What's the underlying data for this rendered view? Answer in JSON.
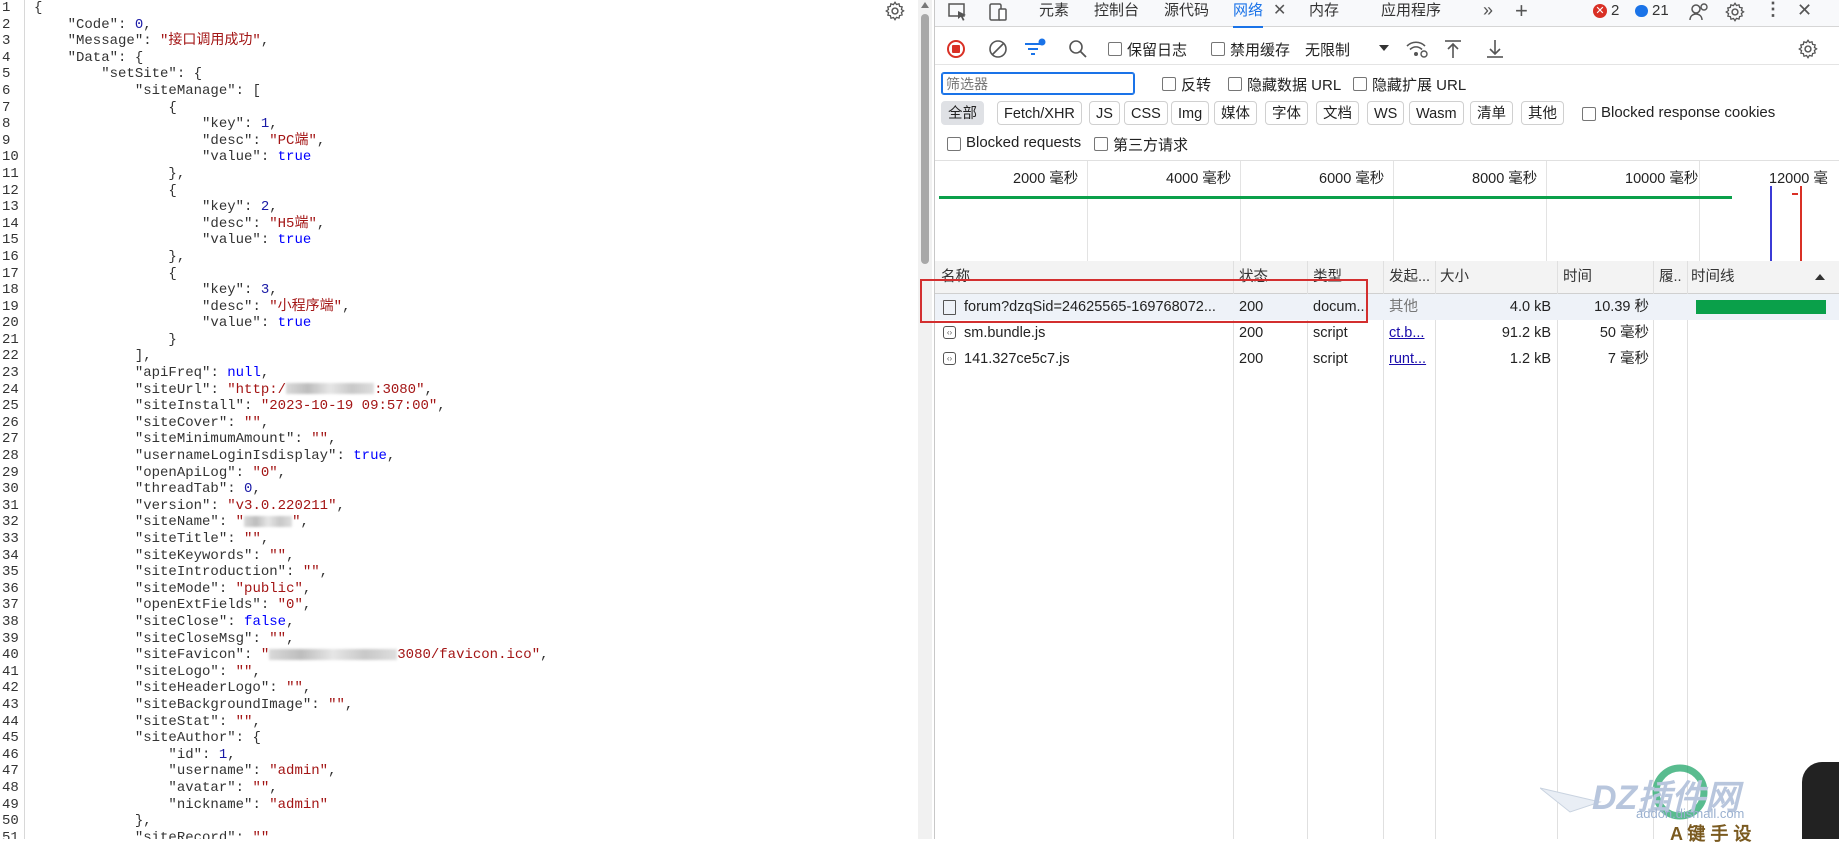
{
  "json_viewer": {
    "line_numbers": [
      "1",
      "2",
      "3",
      "4",
      "5",
      "6",
      "7",
      "8",
      "9",
      "10",
      "11",
      "12",
      "13",
      "14",
      "15",
      "16",
      "17",
      "18",
      "19",
      "20",
      "21",
      "22",
      "23",
      "24",
      "25",
      "26",
      "27",
      "28",
      "29",
      "30",
      "31",
      "32",
      "33",
      "34",
      "35",
      "36",
      "37",
      "38",
      "39",
      "40",
      "41",
      "42",
      "43",
      "44",
      "45",
      "46",
      "47",
      "48",
      "49",
      "50",
      "51"
    ],
    "lines": [
      [
        {
          "t": "{",
          "c": "p"
        }
      ],
      [
        {
          "t": "    \"Code\"",
          "c": "k"
        },
        {
          "t": ": ",
          "c": "p"
        },
        {
          "t": "0",
          "c": "n"
        },
        {
          "t": ",",
          "c": "p"
        }
      ],
      [
        {
          "t": "    \"Message\"",
          "c": "k"
        },
        {
          "t": ": ",
          "c": "p"
        },
        {
          "t": "\"接口调用成功\"",
          "c": "s"
        },
        {
          "t": ",",
          "c": "p"
        }
      ],
      [
        {
          "t": "    \"Data\"",
          "c": "k"
        },
        {
          "t": ": {",
          "c": "p"
        }
      ],
      [
        {
          "t": "        \"setSite\"",
          "c": "k"
        },
        {
          "t": ": {",
          "c": "p"
        }
      ],
      [
        {
          "t": "            \"siteManage\"",
          "c": "k"
        },
        {
          "t": ": [",
          "c": "p"
        }
      ],
      [
        {
          "t": "                {",
          "c": "p"
        }
      ],
      [
        {
          "t": "                    \"key\"",
          "c": "k"
        },
        {
          "t": ": ",
          "c": "p"
        },
        {
          "t": "1",
          "c": "n"
        },
        {
          "t": ",",
          "c": "p"
        }
      ],
      [
        {
          "t": "                    \"desc\"",
          "c": "k"
        },
        {
          "t": ": ",
          "c": "p"
        },
        {
          "t": "\"PC端\"",
          "c": "s"
        },
        {
          "t": ",",
          "c": "p"
        }
      ],
      [
        {
          "t": "                    \"value\"",
          "c": "k"
        },
        {
          "t": ": ",
          "c": "p"
        },
        {
          "t": "true",
          "c": "b"
        }
      ],
      [
        {
          "t": "                },",
          "c": "p"
        }
      ],
      [
        {
          "t": "                {",
          "c": "p"
        }
      ],
      [
        {
          "t": "                    \"key\"",
          "c": "k"
        },
        {
          "t": ": ",
          "c": "p"
        },
        {
          "t": "2",
          "c": "n"
        },
        {
          "t": ",",
          "c": "p"
        }
      ],
      [
        {
          "t": "                    \"desc\"",
          "c": "k"
        },
        {
          "t": ": ",
          "c": "p"
        },
        {
          "t": "\"H5端\"",
          "c": "s"
        },
        {
          "t": ",",
          "c": "p"
        }
      ],
      [
        {
          "t": "                    \"value\"",
          "c": "k"
        },
        {
          "t": ": ",
          "c": "p"
        },
        {
          "t": "true",
          "c": "b"
        }
      ],
      [
        {
          "t": "                },",
          "c": "p"
        }
      ],
      [
        {
          "t": "                {",
          "c": "p"
        }
      ],
      [
        {
          "t": "                    \"key\"",
          "c": "k"
        },
        {
          "t": ": ",
          "c": "p"
        },
        {
          "t": "3",
          "c": "n"
        },
        {
          "t": ",",
          "c": "p"
        }
      ],
      [
        {
          "t": "                    \"desc\"",
          "c": "k"
        },
        {
          "t": ": ",
          "c": "p"
        },
        {
          "t": "\"小程序端\"",
          "c": "s"
        },
        {
          "t": ",",
          "c": "p"
        }
      ],
      [
        {
          "t": "                    \"value\"",
          "c": "k"
        },
        {
          "t": ": ",
          "c": "p"
        },
        {
          "t": "true",
          "c": "b"
        }
      ],
      [
        {
          "t": "                }",
          "c": "p"
        }
      ],
      [
        {
          "t": "            ],",
          "c": "p"
        }
      ],
      [
        {
          "t": "            \"apiFreq\"",
          "c": "k"
        },
        {
          "t": ": ",
          "c": "p"
        },
        {
          "t": "null",
          "c": "b"
        },
        {
          "t": ",",
          "c": "p"
        }
      ],
      [
        {
          "t": "            \"siteUrl\"",
          "c": "k"
        },
        {
          "t": ": ",
          "c": "p"
        },
        {
          "t": "\"http:/",
          "c": "s"
        },
        {
          "blur": 11
        },
        {
          "t": ":3080\"",
          "c": "s"
        },
        {
          "t": ",",
          "c": "p"
        }
      ],
      [
        {
          "t": "            \"siteInstall\"",
          "c": "k"
        },
        {
          "t": ": ",
          "c": "p"
        },
        {
          "t": "\"2023-10-19 09:57:00\"",
          "c": "s"
        },
        {
          "t": ",",
          "c": "p"
        }
      ],
      [
        {
          "t": "            \"siteCover\"",
          "c": "k"
        },
        {
          "t": ": ",
          "c": "p"
        },
        {
          "t": "\"\"",
          "c": "s"
        },
        {
          "t": ",",
          "c": "p"
        }
      ],
      [
        {
          "t": "            \"siteMinimumAmount\"",
          "c": "k"
        },
        {
          "t": ": ",
          "c": "p"
        },
        {
          "t": "\"\"",
          "c": "s"
        },
        {
          "t": ",",
          "c": "p"
        }
      ],
      [
        {
          "t": "            \"usernameLoginIsdisplay\"",
          "c": "k"
        },
        {
          "t": ": ",
          "c": "p"
        },
        {
          "t": "true",
          "c": "b"
        },
        {
          "t": ",",
          "c": "p"
        }
      ],
      [
        {
          "t": "            \"openApiLog\"",
          "c": "k"
        },
        {
          "t": ": ",
          "c": "p"
        },
        {
          "t": "\"0\"",
          "c": "s"
        },
        {
          "t": ",",
          "c": "p"
        }
      ],
      [
        {
          "t": "            \"threadTab\"",
          "c": "k"
        },
        {
          "t": ": ",
          "c": "p"
        },
        {
          "t": "0",
          "c": "n"
        },
        {
          "t": ",",
          "c": "p"
        }
      ],
      [
        {
          "t": "            \"version\"",
          "c": "k"
        },
        {
          "t": ": ",
          "c": "p"
        },
        {
          "t": "\"v3.0.220211\"",
          "c": "s"
        },
        {
          "t": ",",
          "c": "p"
        }
      ],
      [
        {
          "t": "            \"siteName\"",
          "c": "k"
        },
        {
          "t": ": ",
          "c": "p"
        },
        {
          "t": "\"",
          "c": "s"
        },
        {
          "blur": 6
        },
        {
          "t": "\"",
          "c": "s"
        },
        {
          "t": ",",
          "c": "p"
        }
      ],
      [
        {
          "t": "            \"siteTitle\"",
          "c": "k"
        },
        {
          "t": ": ",
          "c": "p"
        },
        {
          "t": "\"\"",
          "c": "s"
        },
        {
          "t": ",",
          "c": "p"
        }
      ],
      [
        {
          "t": "            \"siteKeywords\"",
          "c": "k"
        },
        {
          "t": ": ",
          "c": "p"
        },
        {
          "t": "\"\"",
          "c": "s"
        },
        {
          "t": ",",
          "c": "p"
        }
      ],
      [
        {
          "t": "            \"siteIntroduction\"",
          "c": "k"
        },
        {
          "t": ": ",
          "c": "p"
        },
        {
          "t": "\"\"",
          "c": "s"
        },
        {
          "t": ",",
          "c": "p"
        }
      ],
      [
        {
          "t": "            \"siteMode\"",
          "c": "k"
        },
        {
          "t": ": ",
          "c": "p"
        },
        {
          "t": "\"public\"",
          "c": "s"
        },
        {
          "t": ",",
          "c": "p"
        }
      ],
      [
        {
          "t": "            \"openExtFields\"",
          "c": "k"
        },
        {
          "t": ": ",
          "c": "p"
        },
        {
          "t": "\"0\"",
          "c": "s"
        },
        {
          "t": ",",
          "c": "p"
        }
      ],
      [
        {
          "t": "            \"siteClose\"",
          "c": "k"
        },
        {
          "t": ": ",
          "c": "p"
        },
        {
          "t": "false",
          "c": "b"
        },
        {
          "t": ",",
          "c": "p"
        }
      ],
      [
        {
          "t": "            \"siteCloseMsg\"",
          "c": "k"
        },
        {
          "t": ": ",
          "c": "p"
        },
        {
          "t": "\"\"",
          "c": "s"
        },
        {
          "t": ",",
          "c": "p"
        }
      ],
      [
        {
          "t": "            \"siteFavicon\"",
          "c": "k"
        },
        {
          "t": ": ",
          "c": "p"
        },
        {
          "t": "\"",
          "c": "s"
        },
        {
          "blur": 16
        },
        {
          "t": "3080/favicon.ico\"",
          "c": "s"
        },
        {
          "t": ",",
          "c": "p"
        }
      ],
      [
        {
          "t": "            \"siteLogo\"",
          "c": "k"
        },
        {
          "t": ": ",
          "c": "p"
        },
        {
          "t": "\"\"",
          "c": "s"
        },
        {
          "t": ",",
          "c": "p"
        }
      ],
      [
        {
          "t": "            \"siteHeaderLogo\"",
          "c": "k"
        },
        {
          "t": ": ",
          "c": "p"
        },
        {
          "t": "\"\"",
          "c": "s"
        },
        {
          "t": ",",
          "c": "p"
        }
      ],
      [
        {
          "t": "            \"siteBackgroundImage\"",
          "c": "k"
        },
        {
          "t": ": ",
          "c": "p"
        },
        {
          "t": "\"\"",
          "c": "s"
        },
        {
          "t": ",",
          "c": "p"
        }
      ],
      [
        {
          "t": "            \"siteStat\"",
          "c": "k"
        },
        {
          "t": ": ",
          "c": "p"
        },
        {
          "t": "\"\"",
          "c": "s"
        },
        {
          "t": ",",
          "c": "p"
        }
      ],
      [
        {
          "t": "            \"siteAuthor\"",
          "c": "k"
        },
        {
          "t": ": {",
          "c": "p"
        }
      ],
      [
        {
          "t": "                \"id\"",
          "c": "k"
        },
        {
          "t": ": ",
          "c": "p"
        },
        {
          "t": "1",
          "c": "n"
        },
        {
          "t": ",",
          "c": "p"
        }
      ],
      [
        {
          "t": "                \"username\"",
          "c": "k"
        },
        {
          "t": ": ",
          "c": "p"
        },
        {
          "t": "\"admin\"",
          "c": "s"
        },
        {
          "t": ",",
          "c": "p"
        }
      ],
      [
        {
          "t": "                \"avatar\"",
          "c": "k"
        },
        {
          "t": ": ",
          "c": "p"
        },
        {
          "t": "\"\"",
          "c": "s"
        },
        {
          "t": ",",
          "c": "p"
        }
      ],
      [
        {
          "t": "                \"nickname\"",
          "c": "k"
        },
        {
          "t": ": ",
          "c": "p"
        },
        {
          "t": "\"admin\"",
          "c": "s"
        }
      ],
      [
        {
          "t": "            },",
          "c": "p"
        }
      ],
      [
        {
          "t": "            \"siteRecord\"",
          "c": "k"
        },
        {
          "t": ": ",
          "c": "p"
        },
        {
          "t": "\"\"",
          "c": "s"
        },
        {
          "t": ",",
          "c": "p"
        }
      ]
    ]
  },
  "devtools": {
    "tabs": {
      "elements": "元素",
      "console": "控制台",
      "sources": "源代码",
      "network": "网络",
      "memory": "内存",
      "application": "应用程序"
    },
    "badges": {
      "errors": "2",
      "messages": "21"
    },
    "toolbar": {
      "preserve_log": "保留日志",
      "disable_cache": "禁用缓存",
      "throttle": "无限制"
    },
    "filter": {
      "placeholder": "筛选器",
      "invert": "反转",
      "hide_data_url": "隐藏数据 URL",
      "hide_ext_url": "隐藏扩展 URL",
      "chips": [
        "全部",
        "Fetch/XHR",
        "JS",
        "CSS",
        "Img",
        "媒体",
        "字体",
        "文档",
        "WS",
        "Wasm",
        "清单",
        "其他"
      ],
      "blocked_cookies": "Blocked response cookies",
      "blocked_requests": "Blocked requests",
      "third_party": "第三方请求"
    },
    "overview_ticks": [
      "2000  毫秒",
      "4000  毫秒",
      "6000  毫秒",
      "8000  毫秒",
      "10000  毫秒",
      "12000  毫"
    ],
    "columns": {
      "name": "名称",
      "status": "状态",
      "type": "类型",
      "initiator": "发起...",
      "size": "大小",
      "time": "时间",
      "fulfilled": "履..",
      "waterfall": "时间线"
    },
    "requests": [
      {
        "name": "forum?dzqSid=24625565-169768072...",
        "status": "200",
        "type": "docum...",
        "initiator": "其他",
        "size": "4.0 kB",
        "time": "10.39 秒"
      },
      {
        "name": "sm.bundle.js",
        "status": "200",
        "type": "script",
        "initiator": "ct.b...",
        "size": "91.2 kB",
        "time": "50  毫秒"
      },
      {
        "name": "141.327ce5c7.js",
        "status": "200",
        "type": "script",
        "initiator": "runt...",
        "size": "1.2 kB",
        "time": "7  毫秒"
      }
    ],
    "colors": {
      "accent": "#1a73e8",
      "record": "#d93025",
      "waterfall": "#0aa04a",
      "highlight": "#d32f2f"
    }
  },
  "watermark": {
    "site": "DZ插件网",
    "url": "addon.dismall.com",
    "slogan": "A 键 手 设"
  }
}
